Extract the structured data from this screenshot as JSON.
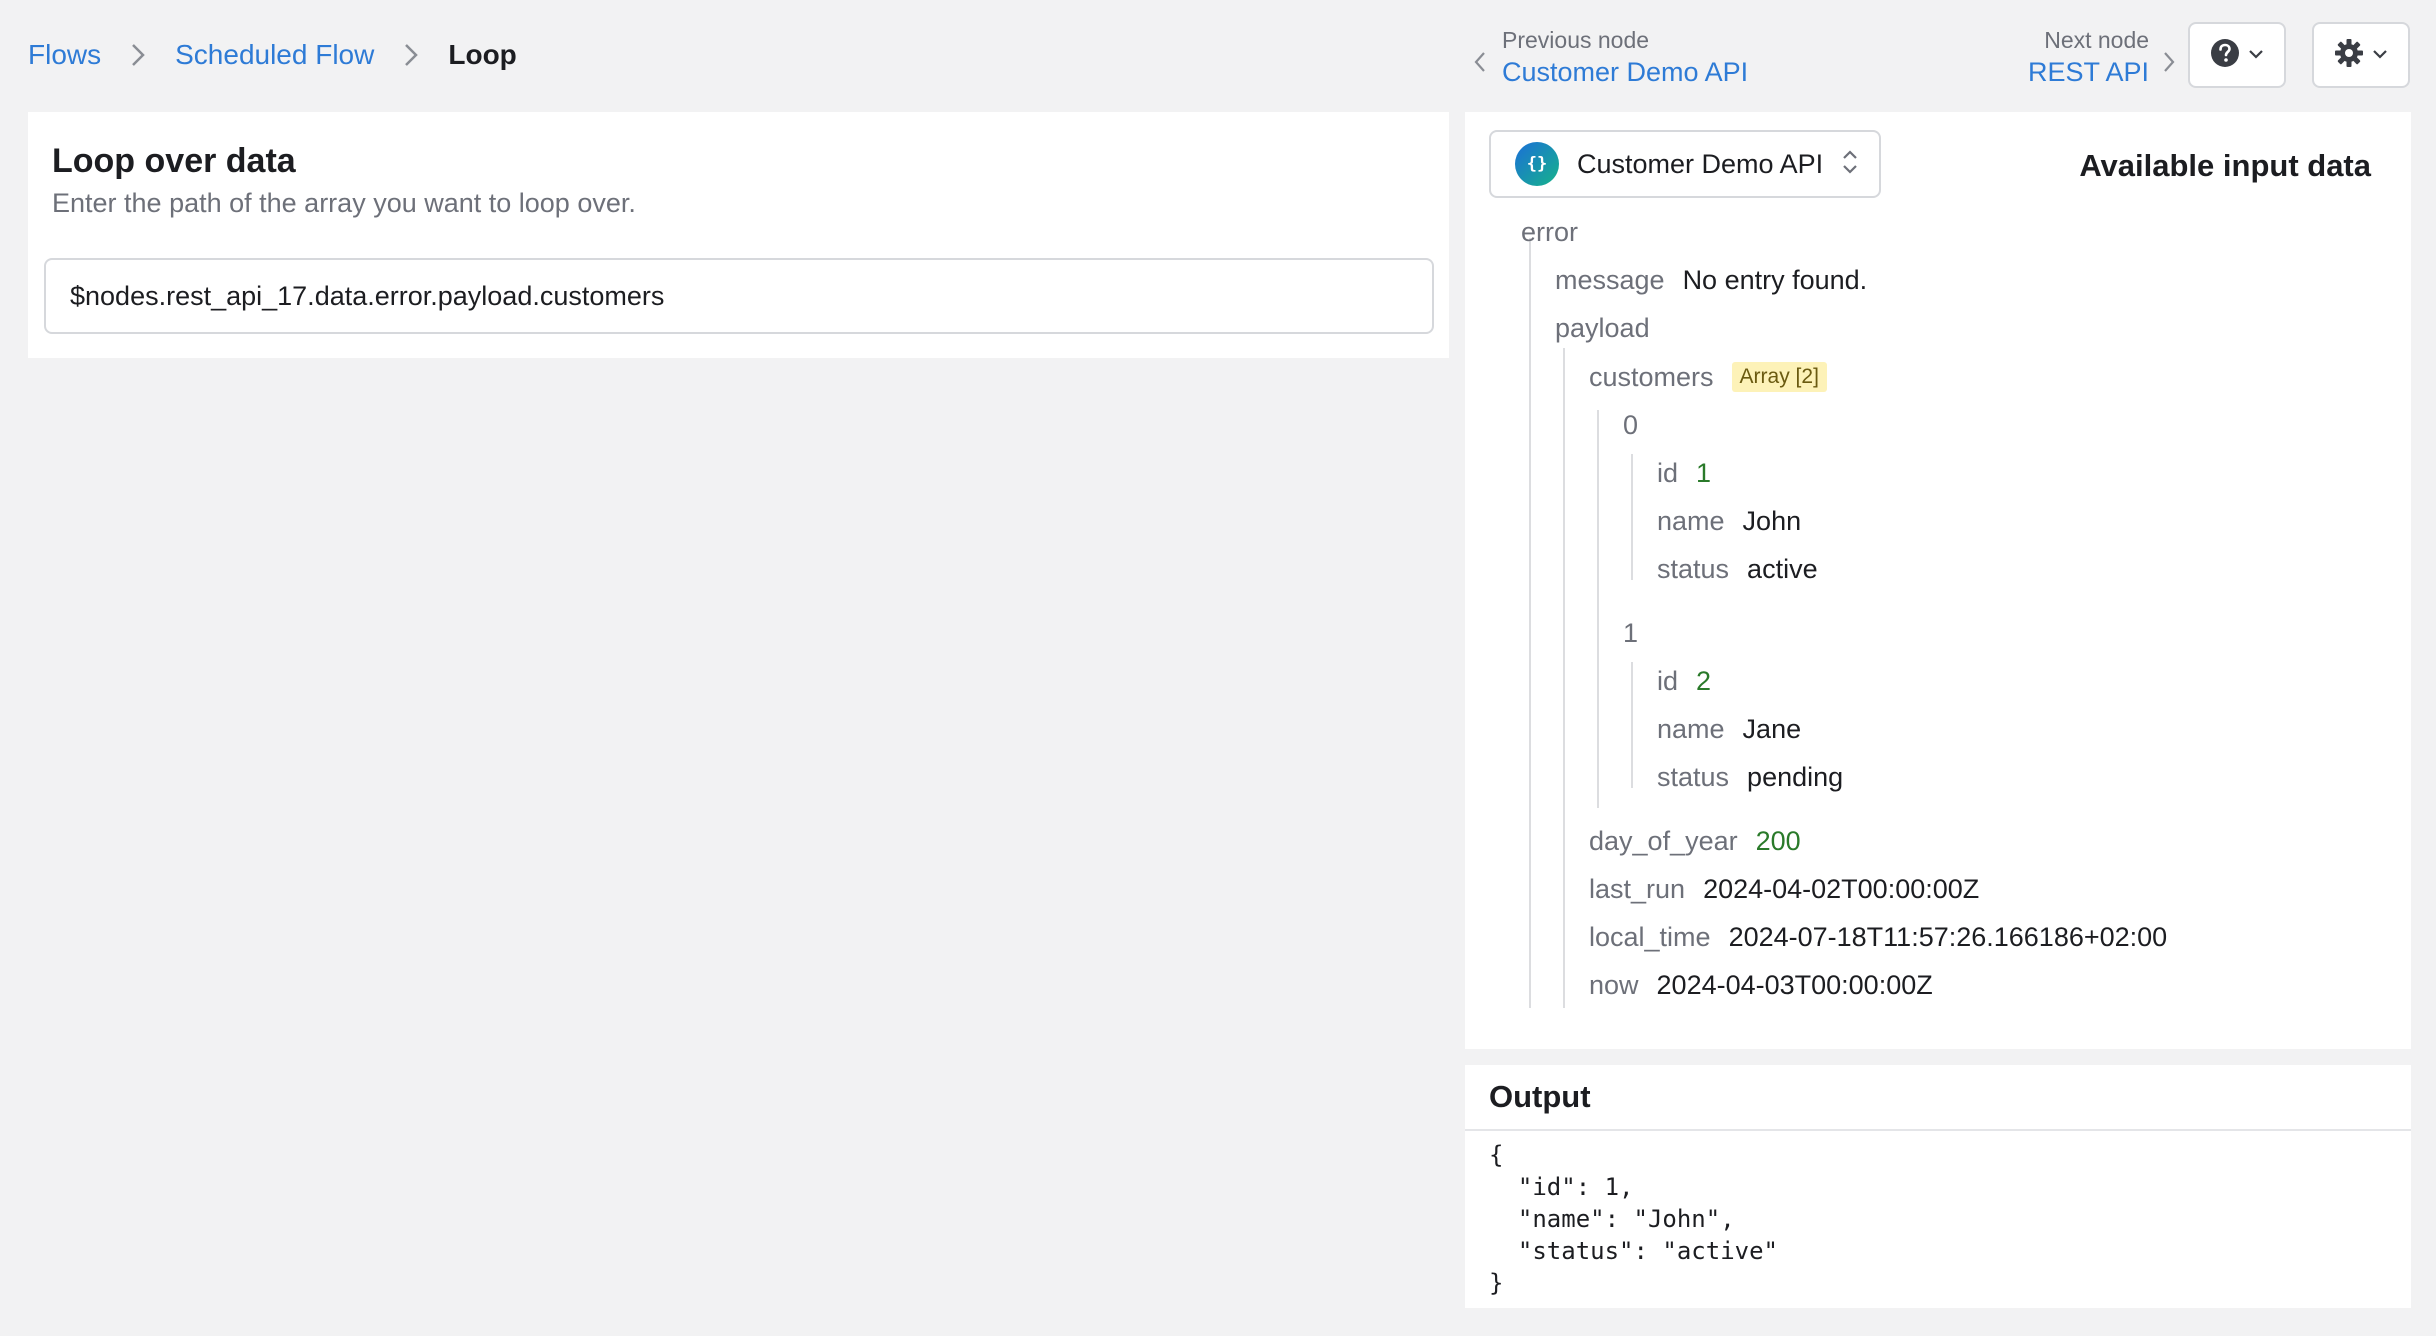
{
  "breadcrumb": {
    "items": [
      "Flows",
      "Scheduled Flow"
    ],
    "current": "Loop"
  },
  "navigation": {
    "previous": {
      "caption": "Previous node",
      "name": "Customer Demo API"
    },
    "next": {
      "caption": "Next node",
      "name": "REST API"
    }
  },
  "toolbar": {
    "help_icon": "question-circle-icon",
    "settings_icon": "gear-icon"
  },
  "loop": {
    "title": "Loop over data",
    "description": "Enter the path of the array you want to loop over.",
    "path_value": "$nodes.rest_api_17.data.error.payload.customers"
  },
  "input_data": {
    "source": {
      "label": "Customer Demo API",
      "logo_text": "{}"
    },
    "title": "Available input data",
    "tree": {
      "error_key": "error",
      "message_key": "message",
      "message_value": "No entry found.",
      "payload_key": "payload",
      "customers_key": "customers",
      "customers_badge": "Array [2]",
      "customers": [
        {
          "index": "0",
          "id_key": "id",
          "id": "1",
          "name_key": "name",
          "name": "John",
          "status_key": "status",
          "status": "active"
        },
        {
          "index": "1",
          "id_key": "id",
          "id": "2",
          "name_key": "name",
          "name": "Jane",
          "status_key": "status",
          "status": "pending"
        }
      ],
      "day_of_year_key": "day_of_year",
      "day_of_year": "200",
      "last_run_key": "last_run",
      "last_run": "2024-04-02T00:00:00Z",
      "local_time_key": "local_time",
      "local_time": "2024-07-18T11:57:26.166186+02:00",
      "now_key": "now",
      "now": "2024-04-03T00:00:00Z"
    }
  },
  "output": {
    "title": "Output",
    "code": "{\n  \"id\": 1,\n  \"name\": \"John\",\n  \"status\": \"active\"\n}"
  },
  "colors": {
    "link": "#2e7bd6",
    "number": "#2a7a2a",
    "badge_bg": "#fdf2b8",
    "background": "#f2f2f3"
  }
}
